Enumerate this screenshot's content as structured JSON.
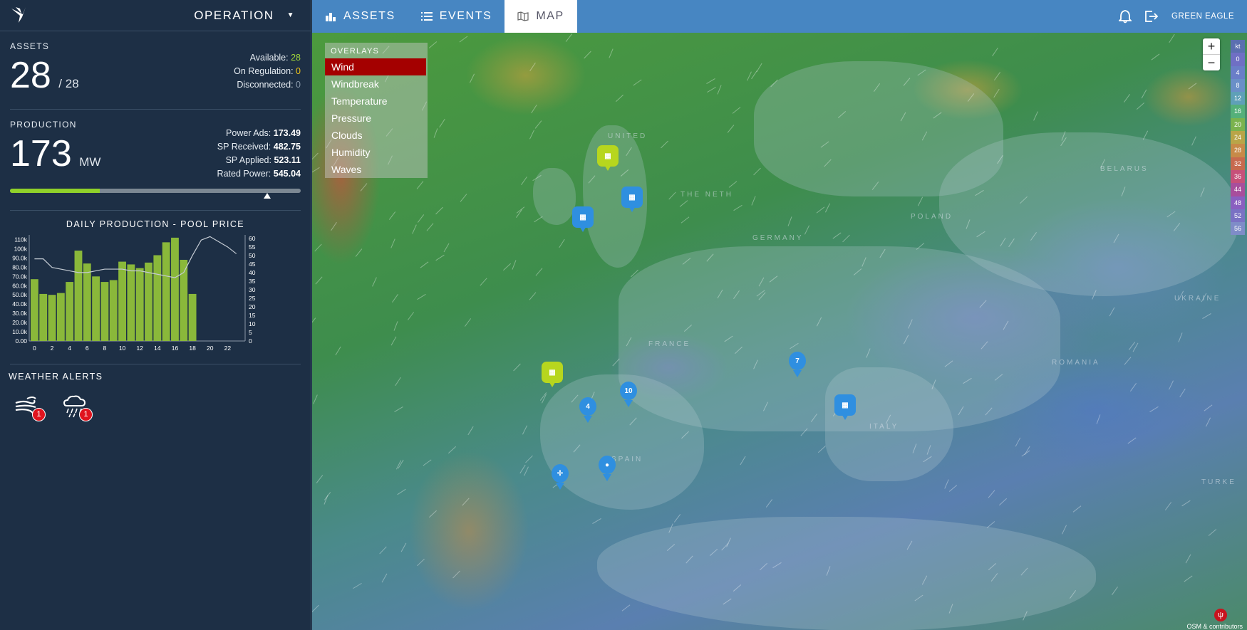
{
  "sidebar": {
    "mode_label": "OPERATION",
    "assets": {
      "label": "ASSETS",
      "value": "28",
      "total": "/ 28",
      "available_label": "Available:",
      "available_value": "28",
      "on_regulation_label": "On Regulation:",
      "on_regulation_value": "0",
      "disconnected_label": "Disconnected:",
      "disconnected_value": "0"
    },
    "production": {
      "label": "PRODUCTION",
      "value": "173",
      "unit": "MW",
      "power_ads_label": "Power Ads:",
      "power_ads_value": "173.49",
      "sp_received_label": "SP Received:",
      "sp_received_value": "482.75",
      "sp_applied_label": "SP Applied:",
      "sp_applied_value": "523.11",
      "rated_power_label": "Rated Power:",
      "rated_power_value": "545.04",
      "progress_fraction": 0.31,
      "marker_fraction": 0.885
    },
    "daily_chart_title": "DAILY PRODUCTION - POOL PRICE",
    "weather_alerts": {
      "label": "WEATHER ALERTS",
      "alerts": [
        {
          "icon": "wind-alert-icon",
          "count": "1"
        },
        {
          "icon": "rain-storm-alert-icon",
          "count": "1"
        }
      ]
    }
  },
  "chart_data": {
    "type": "bar",
    "title": "DAILY PRODUCTION - POOL PRICE",
    "x": [
      0,
      1,
      2,
      3,
      4,
      5,
      6,
      7,
      8,
      9,
      10,
      11,
      12,
      13,
      14,
      15,
      16,
      17,
      18
    ],
    "values": [
      67000,
      51000,
      50000,
      52000,
      64000,
      98000,
      84000,
      70000,
      64000,
      66000,
      86000,
      83000,
      79000,
      85000,
      93000,
      107000,
      112000,
      88000,
      51000
    ],
    "bar_color": "#8ab83a",
    "line_series": {
      "name": "",
      "x": [
        0,
        1,
        2,
        3,
        4,
        5,
        6,
        7,
        8,
        9,
        10,
        11,
        12,
        13,
        14,
        15,
        16,
        17,
        18,
        19,
        20,
        21,
        22,
        23
      ],
      "values": [
        48,
        48,
        43,
        42,
        41,
        40,
        40,
        41,
        42,
        42,
        42,
        41,
        41,
        40,
        39,
        38,
        37,
        40,
        50,
        59,
        61,
        58,
        55,
        51
      ],
      "color": "#c5ccd4"
    },
    "y_ticks": [
      "0.00",
      "10.0k",
      "20.0k",
      "30.0k",
      "40.0k",
      "50.0k",
      "60.0k",
      "70.0k",
      "80.0k",
      "90.0k",
      "100k",
      "110k"
    ],
    "y2_ticks": [
      "0",
      "5",
      "10",
      "15",
      "20",
      "25",
      "30",
      "35",
      "40",
      "45",
      "50",
      "55",
      "60"
    ],
    "x_ticks": [
      "0",
      "2",
      "4",
      "6",
      "8",
      "10",
      "12",
      "14",
      "16",
      "18",
      "20",
      "22"
    ],
    "ylim": [
      0,
      115000
    ],
    "y2lim": [
      0,
      62
    ],
    "xlim": [
      -0.6,
      24
    ]
  },
  "topbar": {
    "tabs": [
      {
        "label": "ASSETS",
        "icon": "assets-icon"
      },
      {
        "label": "EVENTS",
        "icon": "list-icon"
      },
      {
        "label": "MAP",
        "icon": "map-icon"
      }
    ],
    "user": "GREEN EAGLE"
  },
  "map": {
    "overlays_title": "OVERLAYS",
    "overlays": [
      "Wind",
      "Windbreak",
      "Temperature",
      "Pressure",
      "Clouds",
      "Humidity",
      "Waves"
    ],
    "active_overlay": "Wind",
    "countries": [
      "UNITED",
      "THE NETH",
      "POLAND",
      "GERMANY",
      "FRANCE",
      "ROMANIA",
      "UKRAINE",
      "SPAIN",
      "ITALY",
      "TURKE",
      "BELARUS"
    ],
    "zoom_in": "+",
    "zoom_out": "−",
    "legend_unit": "kt",
    "legend_values": [
      "0",
      "4",
      "8",
      "12",
      "16",
      "20",
      "24",
      "28",
      "32",
      "36",
      "44",
      "48",
      "52",
      "56"
    ],
    "legend_colors": [
      "#6f6fc4",
      "#6a7ec8",
      "#6a8fc8",
      "#5fa0b8",
      "#55b07a",
      "#7bb34e",
      "#b9a548",
      "#c78a48",
      "#c76a4e",
      "#c6507a",
      "#a84e9c",
      "#8a5fc0",
      "#7a72c4",
      "#7f8cc8"
    ],
    "markers": [
      {
        "type": "solar",
        "color": "yg",
        "label": ""
      },
      {
        "type": "solar",
        "color": "blue",
        "label": ""
      },
      {
        "type": "solar",
        "color": "blue",
        "label": ""
      },
      {
        "type": "solar",
        "color": "yg",
        "label": ""
      },
      {
        "type": "cluster",
        "color": "blue",
        "label": "4"
      },
      {
        "type": "cluster",
        "color": "blue",
        "label": "10"
      },
      {
        "type": "cluster",
        "color": "blue",
        "label": "7"
      },
      {
        "type": "solar",
        "color": "blue",
        "label": ""
      },
      {
        "type": "wind",
        "color": "blue",
        "label": ""
      },
      {
        "type": "hydro",
        "color": "blue",
        "label": ""
      }
    ],
    "attribution": "OSM & contributors"
  }
}
